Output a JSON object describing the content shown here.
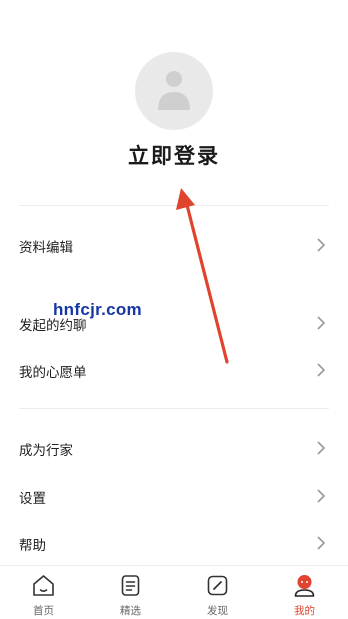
{
  "profile": {
    "avatar_icon": "user-avatar-icon",
    "login_label": "立即登录"
  },
  "menu": {
    "group1": [
      {
        "label": "资料编辑",
        "icon": "chevron-right-icon"
      }
    ],
    "group2": [
      {
        "label": "发起的约聊",
        "icon": "chevron-right-icon"
      },
      {
        "label": "我的心愿单",
        "icon": "chevron-right-icon"
      }
    ],
    "group3": [
      {
        "label": "成为行家",
        "icon": "chevron-right-icon"
      },
      {
        "label": "设置",
        "icon": "chevron-right-icon"
      },
      {
        "label": "帮助",
        "icon": "chevron-right-icon"
      }
    ]
  },
  "watermark": "hnfcjr.com",
  "tabbar": {
    "tabs": [
      {
        "label": "首页",
        "icon": "home-icon",
        "active": false
      },
      {
        "label": "精选",
        "icon": "document-list-icon",
        "active": false
      },
      {
        "label": "发现",
        "icon": "compass-icon",
        "active": false
      },
      {
        "label": "我的",
        "icon": "profile-face-icon",
        "active": true
      }
    ]
  },
  "colors": {
    "accent": "#e2432f",
    "arrow": "#e0442f",
    "text": "#222222",
    "muted": "#666666",
    "avatar_bg": "#e9e9e9",
    "watermark": "#1537a8"
  }
}
